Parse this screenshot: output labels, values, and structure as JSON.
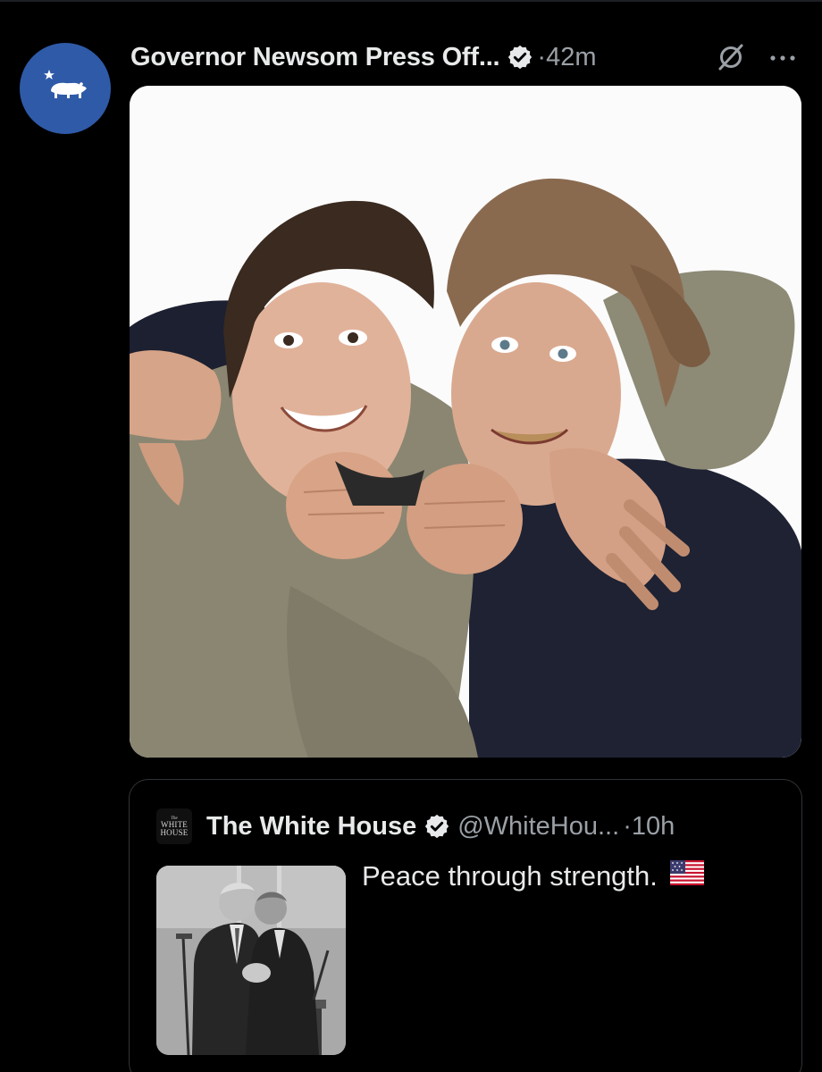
{
  "post": {
    "author_name": "Governor Newsom Press Off...",
    "separator_time": "·42m",
    "avatar_icon": "california-bear-icon",
    "verified_icon": "verified-badge-icon",
    "grok_icon": "grok-icon",
    "more_icon": "more-options-icon",
    "media_icon": "photo-two-men-embracing"
  },
  "quote": {
    "author_name": "The White House",
    "handle": "@WhiteHou...",
    "separator_time": "·10h",
    "text": "Peace through strength.",
    "avatar": {
      "line1": "The",
      "line2": "WHITE",
      "line3": "HOUSE"
    },
    "flag_icon": "us-flag-emoji",
    "thumbnail_icon": "photo-two-men-handshake-bw"
  },
  "colors": {
    "background": "#000000",
    "text_primary": "#e7e9ea",
    "text_secondary": "#9aa0a6",
    "avatar_blue": "#2f5aa8",
    "verified_badge": "#e7e9ea",
    "card_border": "#2f3336"
  }
}
